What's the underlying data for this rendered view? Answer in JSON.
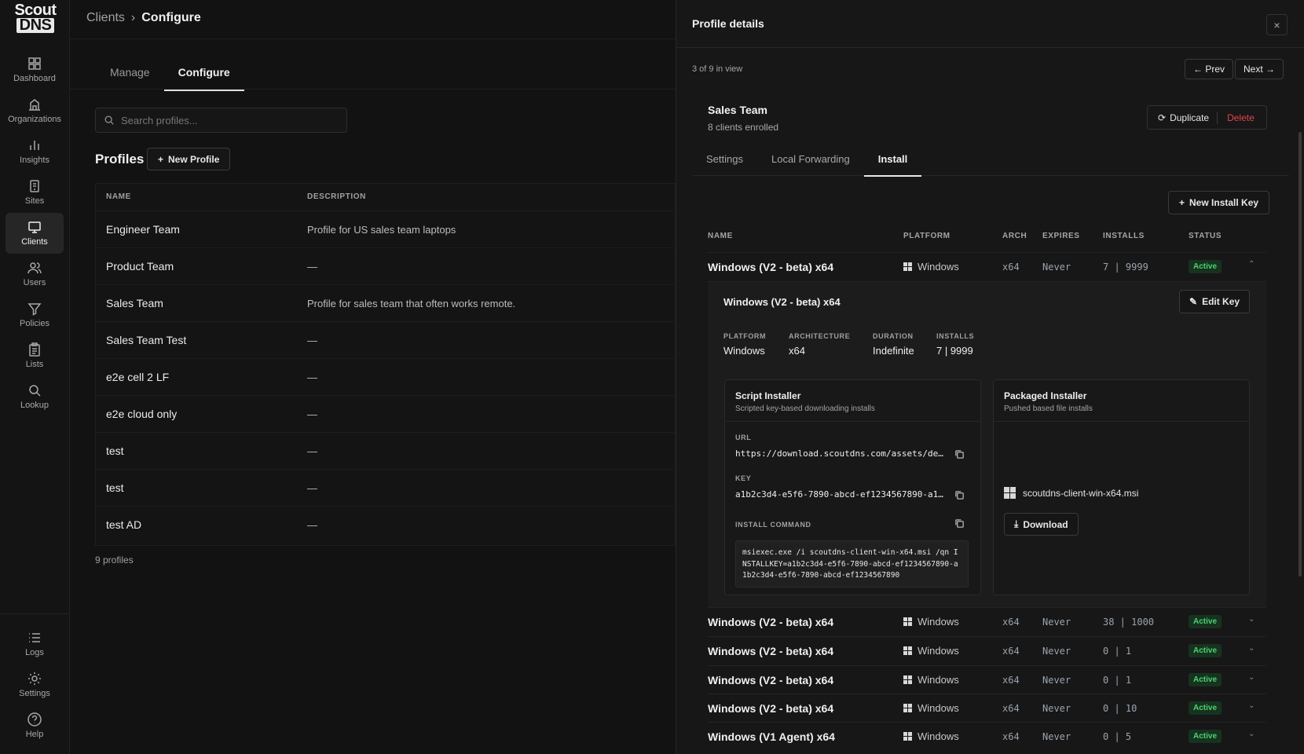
{
  "brand": {
    "line1": "Scout",
    "line2": "DNS"
  },
  "nav": {
    "items": [
      {
        "label": "Dashboard",
        "icon": "grid-icon"
      },
      {
        "label": "Organizations",
        "icon": "building-icon"
      },
      {
        "label": "Insights",
        "icon": "bar-chart-icon"
      },
      {
        "label": "Sites",
        "icon": "site-icon"
      },
      {
        "label": "Clients",
        "icon": "monitor-icon",
        "active": true
      },
      {
        "label": "Users",
        "icon": "users-icon"
      },
      {
        "label": "Policies",
        "icon": "filter-icon"
      },
      {
        "label": "Lists",
        "icon": "clipboard-icon"
      },
      {
        "label": "Lookup",
        "icon": "search-icon"
      }
    ],
    "bottom": [
      {
        "label": "Logs",
        "icon": "list-icon"
      },
      {
        "label": "Settings",
        "icon": "gear-icon"
      },
      {
        "label": "Help",
        "icon": "help-icon"
      }
    ]
  },
  "breadcrumb": {
    "parent": "Clients",
    "sep": "›",
    "current": "Configure"
  },
  "tabs": {
    "manage": "Manage",
    "configure": "Configure"
  },
  "search": {
    "placeholder": "Search profiles..."
  },
  "profiles": {
    "title": "Profiles",
    "new_button": "New Profile",
    "columns": {
      "name": "NAME",
      "description": "DESCRIPTION"
    },
    "rows": [
      {
        "name": "Engineer Team",
        "description": "Profile for US sales team laptops"
      },
      {
        "name": "Product Team",
        "description": "—"
      },
      {
        "name": "Sales Team",
        "description": "Profile for sales team that often works remote."
      },
      {
        "name": "Sales Team Test",
        "description": "—"
      },
      {
        "name": "e2e cell 2 LF",
        "description": "—"
      },
      {
        "name": "e2e cloud only",
        "description": "—"
      },
      {
        "name": "test",
        "description": "—"
      },
      {
        "name": "test",
        "description": "—"
      },
      {
        "name": "test AD",
        "description": "—"
      }
    ],
    "count": "9 profiles"
  },
  "drawer": {
    "title": "Profile details",
    "close": "×",
    "position": "3 of 9 in view",
    "prev": "← Prev",
    "next": "Next →",
    "profile_name": "Sales Team",
    "enrolled": "8 clients enrolled",
    "duplicate": "Duplicate",
    "delete": "Delete",
    "tabs": {
      "settings": "Settings",
      "local_forwarding": "Local Forwarding",
      "install": "Install"
    },
    "new_install_key": "New Install Key",
    "columns": {
      "name": "NAME",
      "platform": "PLATFORM",
      "arch": "ARCH",
      "expires": "EXPIRES",
      "installs": "INSTALLS",
      "status": "STATUS"
    },
    "keys": [
      {
        "name": "Windows (V2 - beta) x64",
        "platform": "Windows",
        "arch": "x64",
        "expires": "Never",
        "installs": "7 | 9999",
        "status": "Active",
        "chevron": "⌃"
      },
      {
        "name": "Windows (V2 - beta) x64",
        "platform": "Windows",
        "arch": "x64",
        "expires": "Never",
        "installs": "38 | 1000",
        "status": "Active",
        "chevron": "⌄"
      },
      {
        "name": "Windows (V2 - beta) x64",
        "platform": "Windows",
        "arch": "x64",
        "expires": "Never",
        "installs": "0 | 1",
        "status": "Active",
        "chevron": "⌄"
      },
      {
        "name": "Windows (V2 - beta) x64",
        "platform": "Windows",
        "arch": "x64",
        "expires": "Never",
        "installs": "0 | 1",
        "status": "Active",
        "chevron": "⌄"
      },
      {
        "name": "Windows (V2 - beta) x64",
        "platform": "Windows",
        "arch": "x64",
        "expires": "Never",
        "installs": "0 | 10",
        "status": "Active",
        "chevron": "⌄"
      },
      {
        "name": "Windows (V1 Agent) x64",
        "platform": "Windows",
        "arch": "x64",
        "expires": "Never",
        "installs": "0 | 5",
        "status": "Active",
        "chevron": "⌄"
      }
    ],
    "expanded": {
      "title": "Windows (V2 - beta) x64",
      "edit_key": "Edit Key",
      "meta": [
        {
          "label": "PLATFORM",
          "value": "Windows"
        },
        {
          "label": "ARCHITECTURE",
          "value": "x64"
        },
        {
          "label": "DURATION",
          "value": "Indefinite"
        },
        {
          "label": "INSTALLS",
          "value": "7 | 9999"
        }
      ],
      "script": {
        "title": "Script Installer",
        "subtitle": "Scripted key-based downloading installs",
        "url_label": "URL",
        "url": "https://download.scoutdns.com/assets/de…",
        "key_label": "KEY",
        "key": "a1b2c3d4-e5f6-7890-abcd-ef1234567890-a1…",
        "command_label": "INSTALL COMMAND",
        "command": "msiexec.exe /i scoutdns-client-win-x64.msi /qn INSTALLKEY=a1b2c3d4-e5f6-7890-abcd-ef1234567890-a1b2c3d4-e5f6-7890-abcd-ef1234567890"
      },
      "packaged": {
        "title": "Packaged Installer",
        "subtitle": "Pushed based file installs",
        "file": "scoutdns-client-win-x64.msi",
        "download": "Download"
      }
    }
  },
  "colors": {
    "active_badge_bg": "#16331f",
    "active_badge_fg": "#4fd073",
    "delete": "#e2454a",
    "background": "#121212"
  }
}
